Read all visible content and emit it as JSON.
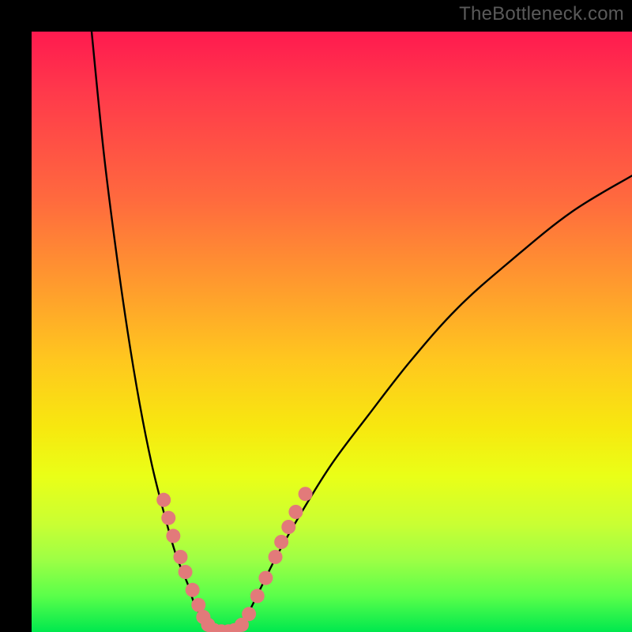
{
  "watermark": "TheBottleneck.com",
  "gradient": {
    "top": "#ff1a4f",
    "mid_upper": "#ff9a2e",
    "mid": "#f7e80f",
    "lower": "#9dff45",
    "bottom": "#00e84e"
  },
  "chart_data": {
    "type": "line",
    "title": "",
    "xlabel": "",
    "ylabel": "",
    "xlim": [
      0,
      100
    ],
    "ylim": [
      0,
      100
    ],
    "grid": false,
    "legend": false,
    "series": [
      {
        "name": "left-branch",
        "x": [
          10,
          12,
          14,
          16,
          18,
          20,
          22,
          24,
          26,
          27,
          28,
          29,
          30
        ],
        "y": [
          100,
          80,
          64,
          50,
          38,
          28,
          20,
          13,
          8,
          5,
          3,
          1.5,
          0
        ]
      },
      {
        "name": "floor",
        "x": [
          30,
          31,
          32,
          33,
          34
        ],
        "y": [
          0,
          0,
          0,
          0,
          0
        ]
      },
      {
        "name": "right-branch",
        "x": [
          34,
          36,
          38,
          41,
          45,
          50,
          56,
          63,
          71,
          80,
          90,
          100
        ],
        "y": [
          0,
          3,
          7,
          13,
          20,
          28,
          36,
          45,
          54,
          62,
          70,
          76
        ]
      }
    ],
    "markers": {
      "name": "dots",
      "color": "#e27a7a",
      "radius": 9,
      "points": [
        {
          "x": 22.0,
          "y": 22
        },
        {
          "x": 22.8,
          "y": 19
        },
        {
          "x": 23.6,
          "y": 16
        },
        {
          "x": 24.8,
          "y": 12.5
        },
        {
          "x": 25.6,
          "y": 10
        },
        {
          "x": 26.8,
          "y": 7
        },
        {
          "x": 27.8,
          "y": 4.5
        },
        {
          "x": 28.6,
          "y": 2.5
        },
        {
          "x": 29.4,
          "y": 1.2
        },
        {
          "x": 30.4,
          "y": 0.3
        },
        {
          "x": 31.6,
          "y": 0.1
        },
        {
          "x": 32.8,
          "y": 0.1
        },
        {
          "x": 33.8,
          "y": 0.3
        },
        {
          "x": 35.0,
          "y": 1.2
        },
        {
          "x": 36.2,
          "y": 3.0
        },
        {
          "x": 37.6,
          "y": 6.0
        },
        {
          "x": 39.0,
          "y": 9.0
        },
        {
          "x": 40.6,
          "y": 12.5
        },
        {
          "x": 41.6,
          "y": 15
        },
        {
          "x": 42.8,
          "y": 17.5
        },
        {
          "x": 44.0,
          "y": 20
        },
        {
          "x": 45.6,
          "y": 23
        }
      ]
    }
  }
}
